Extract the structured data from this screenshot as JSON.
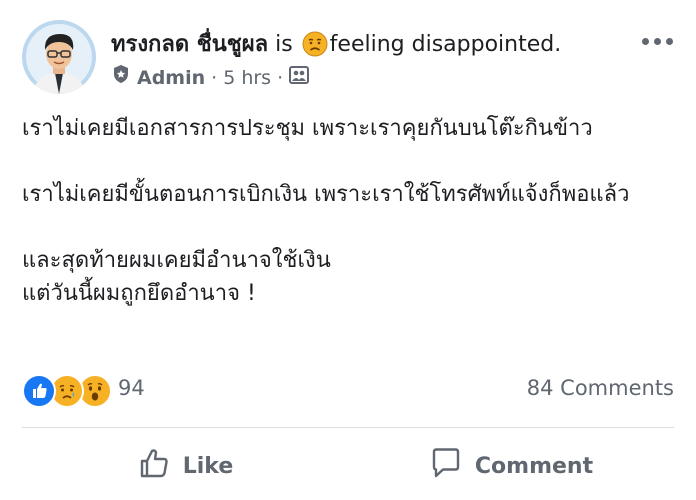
{
  "post": {
    "author": {
      "name": "ทรงกลด ชื่นชูผล",
      "role": "Admin"
    },
    "feeling": {
      "connector": "is",
      "text": "feeling disappointed.",
      "emoji": "disappointed-face-icon"
    },
    "timestamp": "5 hrs",
    "separator": "·",
    "audience": "group-members-icon",
    "body": [
      "เราไม่เคยมีเอกสารการประชุม เพราะเราคุยกันบนโต๊ะกินข้าว",
      "เราไม่เคยมีขั้นตอนการเบิกเงิน เพราะเราใช้โทรศัพท์แจ้งก็พอแล้ว",
      "และสุดท้ายผมเคยมีอำนาจใช้เงิน\nแต่วันนี้ผมถูกยึดอำนาจ !"
    ],
    "reactions": {
      "types": [
        "like",
        "sad",
        "wow"
      ],
      "count": "94"
    },
    "comments_count": "84 Comments",
    "actions": {
      "like": "Like",
      "comment": "Comment"
    }
  },
  "colors": {
    "text": "#1c1e21",
    "secondary": "#606770",
    "like_blue": "#1877f2",
    "emoji_yellow": "#f7b125",
    "divider": "#dadde1"
  }
}
